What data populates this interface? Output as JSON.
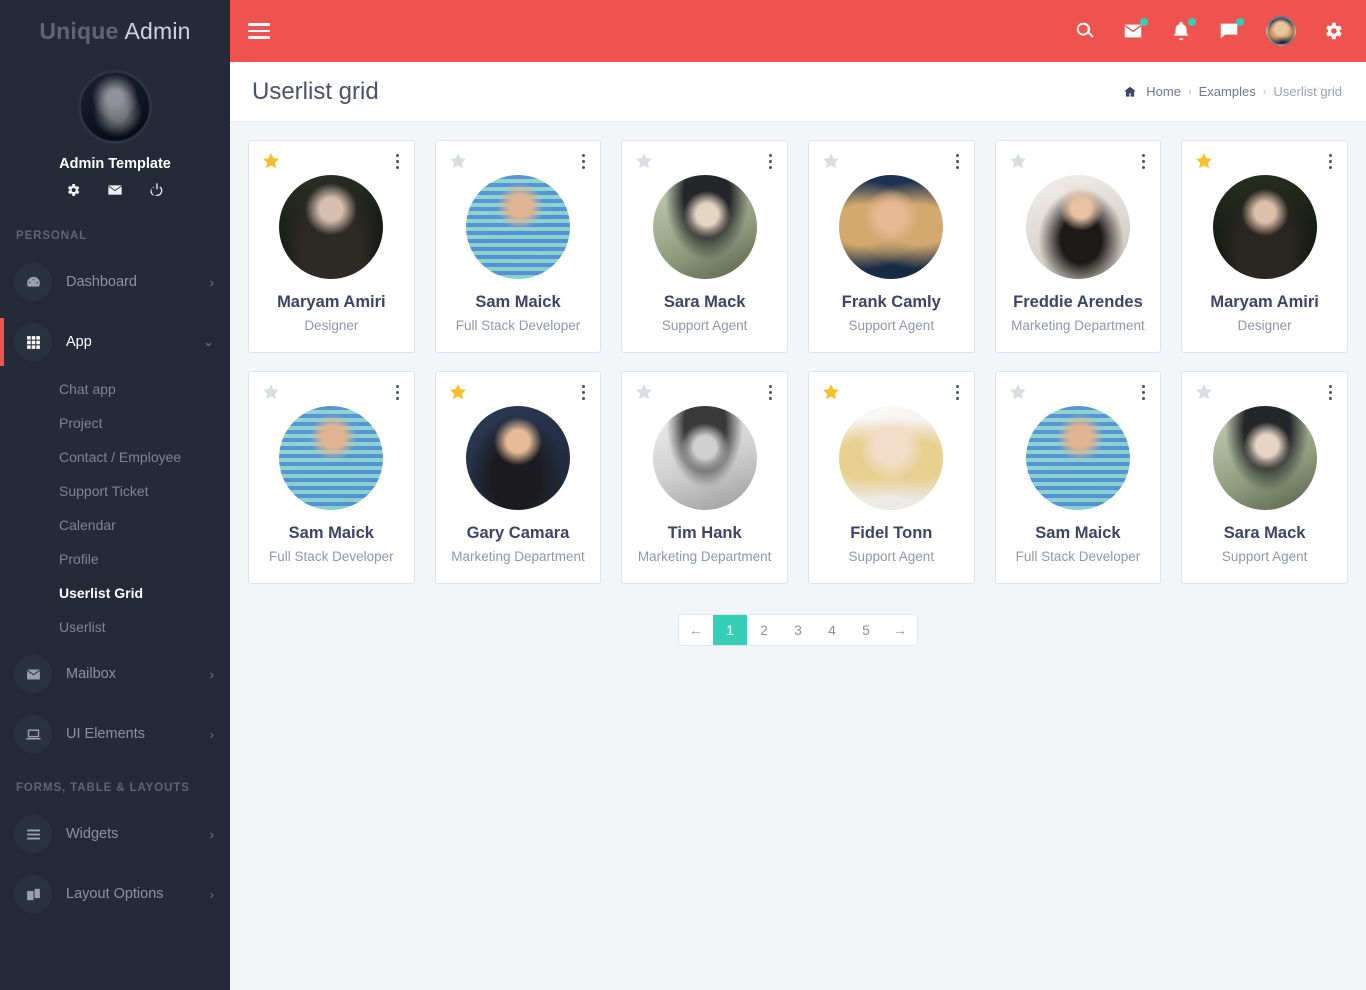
{
  "sidebar": {
    "brand": {
      "bold": "Unique",
      "light": "Admin"
    },
    "profile": {
      "name": "Admin Template",
      "icons": [
        {
          "name": "gear-icon"
        },
        {
          "name": "mail-icon"
        },
        {
          "name": "power-icon"
        }
      ]
    },
    "sections": [
      {
        "label": "PERSONAL",
        "items": [
          {
            "label": "Dashboard",
            "icon": "dashboard-icon",
            "arrow": "›",
            "active": false
          },
          {
            "label": "App",
            "icon": "grid-icon",
            "arrow": "⌄",
            "active": true
          },
          {
            "label": "Mailbox",
            "icon": "mail-icon",
            "arrow": "›",
            "active": false
          },
          {
            "label": "UI Elements",
            "icon": "laptop-icon",
            "arrow": "›",
            "active": false
          }
        ],
        "sub_items": [
          {
            "label": "Chat app",
            "active": false
          },
          {
            "label": "Project",
            "active": false
          },
          {
            "label": "Contact / Employee",
            "active": false
          },
          {
            "label": "Support Ticket",
            "active": false
          },
          {
            "label": "Calendar",
            "active": false
          },
          {
            "label": "Profile",
            "active": false
          },
          {
            "label": "Userlist Grid",
            "active": true
          },
          {
            "label": "Userlist",
            "active": false
          }
        ]
      },
      {
        "label": "FORMS, TABLE & LAYOUTS",
        "items": [
          {
            "label": "Widgets",
            "icon": "bars-icon",
            "arrow": "›",
            "active": false
          },
          {
            "label": "Layout Options",
            "icon": "layers-icon",
            "arrow": "›",
            "active": false
          }
        ]
      }
    ]
  },
  "topbar": {
    "menu_toggle": "hamburger-icon",
    "actions": [
      {
        "name": "search-icon",
        "badge": false
      },
      {
        "name": "mail-icon",
        "badge": true
      },
      {
        "name": "bell-icon",
        "badge": true
      },
      {
        "name": "chat-icon",
        "badge": true
      }
    ],
    "avatar": "user-avatar",
    "settings": "gear-icon"
  },
  "page": {
    "title": "Userlist grid",
    "breadcrumb": {
      "home_icon": "home-icon",
      "items": [
        "Home",
        "Examples",
        "Userlist grid"
      ],
      "separator": "›"
    }
  },
  "users": [
    {
      "name": "Maryam Amiri",
      "role": "Designer",
      "starred": true,
      "avatar_class": "av-1"
    },
    {
      "name": "Sam Maick",
      "role": "Full Stack Developer",
      "starred": false,
      "avatar_class": "av-2"
    },
    {
      "name": "Sara Mack",
      "role": "Support Agent",
      "starred": false,
      "avatar_class": "av-3"
    },
    {
      "name": "Frank Camly",
      "role": "Support Agent",
      "starred": false,
      "avatar_class": "av-4"
    },
    {
      "name": "Freddie Arendes",
      "role": "Marketing Department",
      "starred": false,
      "avatar_class": "av-5"
    },
    {
      "name": "Maryam Amiri",
      "role": "Designer",
      "starred": true,
      "avatar_class": "av-6"
    },
    {
      "name": "Sam Maick",
      "role": "Full Stack Developer",
      "starred": false,
      "avatar_class": "av-2"
    },
    {
      "name": "Gary Camara",
      "role": "Marketing Department",
      "starred": true,
      "avatar_class": "av-7"
    },
    {
      "name": "Tim Hank",
      "role": "Marketing Department",
      "starred": false,
      "avatar_class": "av-8"
    },
    {
      "name": "Fidel Tonn",
      "role": "Support Agent",
      "starred": true,
      "avatar_class": "av-9"
    },
    {
      "name": "Sam Maick",
      "role": "Full Stack Developer",
      "starred": false,
      "avatar_class": "av-2"
    },
    {
      "name": "Sara Mack",
      "role": "Support Agent",
      "starred": false,
      "avatar_class": "av-3"
    }
  ],
  "pagination": {
    "prev": "←",
    "next": "→",
    "pages": [
      "1",
      "2",
      "3",
      "4",
      "5"
    ],
    "active": "1"
  },
  "colors": {
    "header_red": "#ef5350",
    "sidebar_dark": "#242a38",
    "accent_teal": "#35cfb8",
    "star_gold": "#f7c02c",
    "page_bg": "#f4f5f9"
  }
}
